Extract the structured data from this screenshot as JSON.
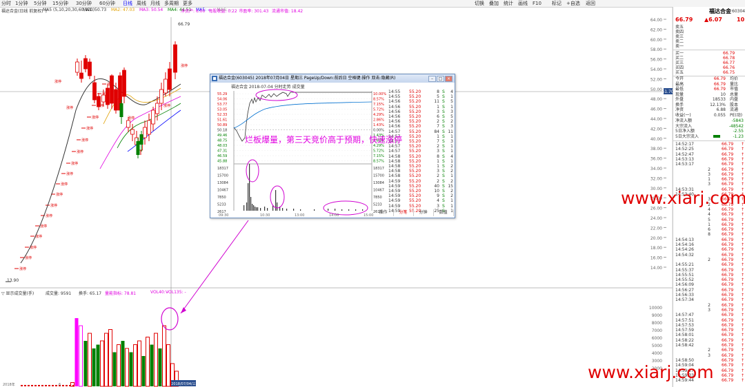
{
  "colors": {
    "up": "#e00000",
    "down": "#008000",
    "magenta": "#e000e0",
    "blue": "#0000ff"
  },
  "toolbar": {
    "periods": [
      "分时",
      "1分钟",
      "5分钟",
      "15分钟",
      "30分钟",
      "60分钟",
      "日线",
      "周线",
      "月线",
      "多周期",
      "更多"
    ],
    "active_index": 6,
    "right_items": [
      "切换",
      "叠加",
      "统计",
      "画线",
      "F10",
      "标记",
      "+自选",
      "返回"
    ]
  },
  "chart_header": {
    "name": "福达合金(日线 前复权) ▽",
    "ma_label": "MA5 (5,10,20,30,60,120)",
    "ma_values": [
      "MA1: 50.73",
      "MA2: 47.03",
      "MA3: 50.54",
      "MA4: 44.51",
      "MA5: --",
      "MA6: --"
    ],
    "extra": [
      "净资产: 6.00",
      "每股收益: 0.22",
      "市盈率: 301.43",
      "流通市值: 18.42"
    ]
  },
  "price_axis": [
    "64.00",
    "62.00",
    "60.00",
    "58.00",
    "56.00",
    "54.00",
    "52.00",
    "50.00",
    "48.00",
    "46.00",
    "44.00",
    "42.00",
    "40.00",
    "38.00",
    "36.00",
    "34.00",
    "32.00",
    "30.00",
    "28.00",
    "26.00",
    "24.00",
    "22.00",
    "20.00",
    "18.00",
    "16.00",
    "14.00"
  ],
  "price_marker": "51.70",
  "top_price_label": "66.79",
  "low_price_label": "13.90",
  "limit_up_tag": "涨停",
  "volume_header": {
    "title": "▽ 显示成交量(手)",
    "amount": "成交量: 9591",
    "turnover": "换手: 65.17",
    "ratio": "量能指标: 78.81",
    "vol_ma": "VOL40: -",
    "vol_ma2": "VOL135: -"
  },
  "volume_axis": [
    "10000",
    "9000",
    "8000",
    "7000",
    "6000",
    "5000",
    "4000",
    "3000",
    "2000"
  ],
  "x_axis": [
    "2018年",
    "6",
    "7"
  ],
  "x_date_tag": "2018/07/04/三",
  "popup": {
    "title": "福达合金(603045) 2018年07月04日 星期三 PageUp/Down:前后日 空格键:操作 双击:隐藏(R)",
    "subtitle": "福达合金  2018-07-04 分时走势 成交量",
    "price_labels": [
      "55.29",
      "54.06",
      "53.77",
      "53.05",
      "52.33",
      "51.61",
      "50.89",
      "50.18",
      "49.46",
      "48.75",
      "48.03",
      "47.31",
      "46.59",
      "45.88"
    ],
    "pct_labels": [
      "10.00%",
      "8.57%",
      "7.15%",
      "5.72%",
      "4.29%",
      "2.86%",
      "1.43%",
      "0.00%",
      "1.43%",
      "2.86%",
      "4.29%",
      "5.72%",
      "7.15%",
      "8.57%"
    ],
    "vol_labels": [
      "18317",
      "15700",
      "13084",
      "10467",
      "7850",
      "5233",
      "2617"
    ],
    "x_labels": [
      "09:30",
      "10:30",
      "13:00",
      "14:00",
      "15:00"
    ],
    "ticks": [
      [
        "14:55",
        "55.20",
        "8",
        "S",
        "4"
      ],
      [
        "14:55",
        "55.20",
        "5",
        "S",
        "1"
      ],
      [
        "14:56",
        "55.20",
        "11",
        "S",
        "5"
      ],
      [
        "14:56",
        "55.20",
        "1",
        "S",
        "1"
      ],
      [
        "14:56",
        "55.20",
        "3",
        "S",
        "3"
      ],
      [
        "14:56",
        "55.20",
        "6",
        "S",
        "5"
      ],
      [
        "14:56",
        "55.20",
        "2",
        "S",
        "2"
      ],
      [
        "14:56",
        "55.20",
        "7",
        "S",
        "3"
      ],
      [
        "14:57",
        "55.20",
        "84",
        "S",
        "11"
      ],
      [
        "14:57",
        "55.20",
        "1",
        "S",
        "1"
      ],
      [
        "14:57",
        "55.20",
        "7",
        "S",
        "3"
      ],
      [
        "14:57",
        "55.20",
        "2",
        "S",
        "1"
      ],
      [
        "14:57",
        "55.20",
        "3",
        "S",
        "1"
      ],
      [
        "14:58",
        "55.20",
        "8",
        "S",
        "4"
      ],
      [
        "14:58",
        "55.20",
        "1",
        "S",
        "1"
      ],
      [
        "14:58",
        "55.20",
        "1",
        "S",
        "2"
      ],
      [
        "14:58",
        "55.20",
        "3",
        "S",
        "2"
      ],
      [
        "14:58",
        "55.20",
        "2",
        "S",
        "1"
      ],
      [
        "14:59",
        "55.20",
        "2",
        "S",
        "2"
      ],
      [
        "14:59",
        "55.20",
        "40",
        "S",
        "15"
      ],
      [
        "14:59",
        "55.20",
        "10",
        "S",
        "2"
      ],
      [
        "14:59",
        "55.20",
        "9",
        "S",
        "2"
      ],
      [
        "14:59",
        "55.20",
        "4",
        "S",
        "1"
      ],
      [
        "14:59",
        "55.20",
        "3",
        "S",
        "1"
      ],
      [
        "14:59",
        "55.20",
        "25",
        "S",
        "1"
      ]
    ],
    "tabs": [
      "操作",
      "分笔",
      "分钟",
      "数值"
    ]
  },
  "annotation": "烂板爆量，第三天竞价高于预期，快速涨停",
  "right_panel": {
    "name": "福达合金",
    "code": "603045",
    "asks": [
      [
        "卖五",
        "",
        ""
      ],
      [
        "卖四",
        "",
        ""
      ],
      [
        "卖三",
        "",
        ""
      ],
      [
        "卖二",
        "",
        ""
      ],
      [
        "卖一",
        "",
        ""
      ]
    ],
    "bids": [
      [
        "买一",
        "66.79",
        ""
      ],
      [
        "买二",
        "66.78",
        ""
      ],
      [
        "买三",
        "66.77",
        ""
      ],
      [
        "买四",
        "66.76",
        ""
      ],
      [
        "买五",
        "66.75",
        ""
      ]
    ],
    "price": "66.79",
    "change": "▲6.07",
    "pct": "10",
    "stats": [
      [
        "今开",
        "66.79",
        "均价",
        ""
      ],
      [
        "最高",
        "66.79",
        "量比",
        ""
      ],
      [
        "最低",
        "66.79",
        "市值",
        ""
      ],
      [
        "现量",
        "10",
        "总量",
        ""
      ],
      [
        "外盘",
        "18533",
        "内盘",
        ""
      ],
      [
        "换手",
        "12.13%",
        "股本",
        ""
      ],
      [
        "净资",
        "6.88",
        "流通",
        ""
      ],
      [
        "收益(一)",
        "0.055",
        "PE(动)",
        ""
      ]
    ],
    "flows": [
      [
        "净流入额",
        "-5843"
      ],
      [
        "大宗流入",
        "-48542"
      ],
      [
        "5日净入额",
        "-2.55"
      ],
      [
        "5日大宗流入",
        "-1.23"
      ]
    ],
    "trades": [
      [
        "14:52:17",
        "",
        "66.79"
      ],
      [
        "14:52:25",
        "",
        "66.79"
      ],
      [
        "14:52:47",
        "",
        "66.79"
      ],
      [
        "14:53:13",
        "",
        "66.79"
      ],
      [
        "14:53:17",
        "",
        "66.79"
      ],
      [
        "",
        "2",
        "66.79"
      ],
      [
        "",
        "3",
        "66.79"
      ],
      [
        "",
        "1",
        "66.79"
      ],
      [
        "",
        "3",
        "66.79"
      ],
      [
        "14:53:31",
        "",
        "66.79"
      ],
      [
        "14:53:40",
        "",
        "66.79"
      ],
      [
        "",
        "3",
        "66.79"
      ],
      [
        "",
        "2",
        "66.79"
      ],
      [
        "",
        "4",
        "66.79"
      ],
      [
        "",
        "4",
        "66.79"
      ],
      [
        "",
        "5",
        "66.79"
      ],
      [
        "",
        "1",
        "66.79"
      ],
      [
        "",
        "6",
        "66.79"
      ],
      [
        "",
        "8",
        "66.79"
      ],
      [
        "14:54:13",
        "",
        "66.79"
      ],
      [
        "14:54:16",
        "",
        "66.79"
      ],
      [
        "14:54:26",
        "",
        "66.79"
      ],
      [
        "14:54:32",
        "",
        "66.79"
      ],
      [
        "",
        "2",
        "66.79"
      ],
      [
        "14:55:21",
        "",
        "66.79"
      ],
      [
        "14:55:37",
        "",
        "66.79"
      ],
      [
        "14:55:51",
        "",
        "66.79"
      ],
      [
        "14:55:52",
        "",
        "66.79"
      ],
      [
        "14:56:09",
        "",
        "66.79"
      ],
      [
        "14:56:27",
        "",
        "66.79"
      ],
      [
        "14:56:33",
        "",
        "66.79"
      ],
      [
        "14:57:34",
        "",
        "66.79"
      ],
      [
        "",
        "2",
        "66.79"
      ],
      [
        "",
        "3",
        "66.79"
      ],
      [
        "14:57:47",
        "",
        "66.79"
      ],
      [
        "14:57:51",
        "",
        "66.79"
      ],
      [
        "14:57:53",
        "",
        "66.79"
      ],
      [
        "14:57:59",
        "",
        "66.79"
      ],
      [
        "14:58:01",
        "",
        "66.79"
      ],
      [
        "14:58:22",
        "",
        "66.79"
      ],
      [
        "14:58:42",
        "",
        "66.79"
      ],
      [
        "",
        "2",
        "66.79"
      ],
      [
        "",
        "3",
        "66.79"
      ],
      [
        "14:58:50",
        "",
        "66.79"
      ],
      [
        "14:59:04",
        "",
        "66.79"
      ],
      [
        "14:59:27",
        "",
        "66.79"
      ],
      [
        "14:59:33",
        "",
        "66.79"
      ],
      [
        "14:59:44",
        "",
        "66.79"
      ]
    ],
    "vol_axis": [
      "10000",
      "9000",
      "8000",
      "7000",
      "6000",
      "5000",
      "4000",
      "3000"
    ]
  },
  "watermarks": [
    "www.xiarj.com",
    "www.xiarj.com"
  ]
}
